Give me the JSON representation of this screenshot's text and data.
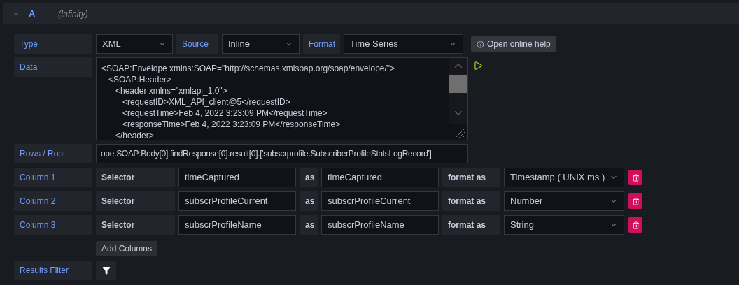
{
  "query": {
    "expanded": true,
    "ref_id": "A",
    "datasource": "(Infinity)"
  },
  "type_row": {
    "label": "Type",
    "value": "XML",
    "source_label": "Source",
    "source_value": "Inline",
    "format_label": "Format",
    "format_value": "Time Series",
    "help_button": "Open online help"
  },
  "data": {
    "label": "Data",
    "value": "<SOAP:Envelope xmlns:SOAP=\"http://schemas.xmlsoap.org/soap/envelope/\">\n   <SOAP:Header>\n      <header xmlns=\"xmlapi_1.0\">\n         <requestID>XML_API_client@5</requestID>\n         <requestTime>Feb 4, 2022 3:23:09 PM</requestTime>\n         <responseTime>Feb 4, 2022 3:23:09 PM</responseTime>\n      </header>"
  },
  "root": {
    "label": "Rows / Root",
    "value": "ope.SOAP:Body[0].findResponse[0].result[0].['subscrprofile.SubscriberProfileStatsLogRecord']"
  },
  "columns": [
    {
      "label": "Column 1",
      "selector_label": "Selector",
      "selector": "timeCaptured",
      "as_label": "as",
      "alias": "timeCaptured",
      "format_label": "format as",
      "format": "Timestamp ( UNIX ms )"
    },
    {
      "label": "Column 2",
      "selector_label": "Selector",
      "selector": "subscrProfileCurrent",
      "as_label": "as",
      "alias": "subscrProfileCurrent",
      "format_label": "format as",
      "format": "Number"
    },
    {
      "label": "Column 3",
      "selector_label": "Selector",
      "selector": "subscrProfileName",
      "as_label": "as",
      "alias": "subscrProfileName",
      "format_label": "format as",
      "format": "String"
    }
  ],
  "add_columns": "Add Columns",
  "results_filter": {
    "label": "Results Filter"
  }
}
